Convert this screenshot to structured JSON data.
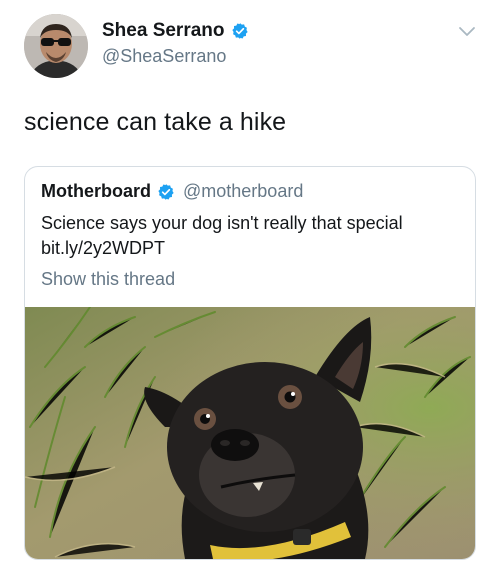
{
  "author": {
    "name": "Shea Serrano",
    "handle": "@SheaSerrano"
  },
  "tweet": {
    "text": "science can take a hike"
  },
  "quote": {
    "name": "Motherboard",
    "handle": "@motherboard",
    "text_line1": "Science says your dog isn't really that special",
    "text_line2": "bit.ly/2y2WDPT",
    "show_thread": "Show this thread"
  },
  "colors": {
    "verified": "#1da1f2",
    "text": "#14171a",
    "secondary": "#657786",
    "border": "#d6dde3"
  },
  "icons": [
    "verified-badge-icon",
    "chevron-down-icon"
  ]
}
